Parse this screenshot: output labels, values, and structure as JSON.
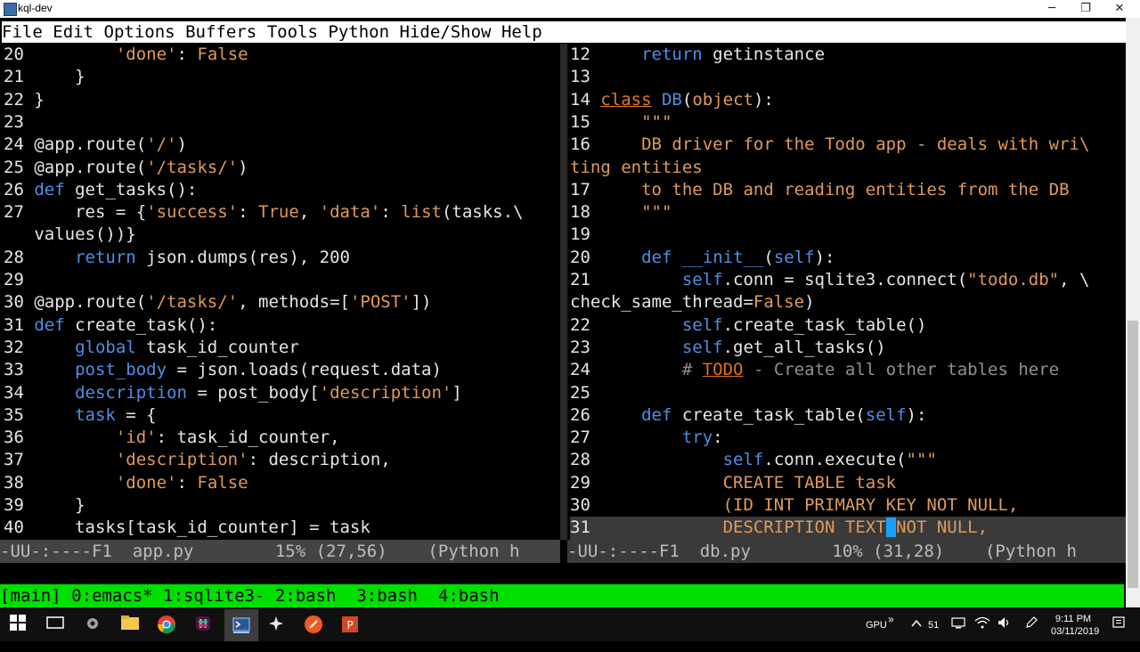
{
  "window": {
    "title": "kql-dev",
    "minimize": "─",
    "maximize": "❐",
    "close": "✕"
  },
  "menu": [
    "File",
    "Edit",
    "Options",
    "Buffers",
    "Tools",
    "Python",
    "Hide/Show",
    "Help"
  ],
  "left_pane": {
    "lines": [
      [
        {
          "t": "20 ",
          "c": "ln"
        },
        {
          "t": "        "
        },
        {
          "t": "'done'",
          "c": "str"
        },
        {
          "t": ": "
        },
        {
          "t": "False",
          "c": "str"
        }
      ],
      [
        {
          "t": "21 ",
          "c": "ln"
        },
        {
          "t": "    }"
        }
      ],
      [
        {
          "t": "22 ",
          "c": "ln"
        },
        {
          "t": "}"
        }
      ],
      [
        {
          "t": "23 ",
          "c": "ln"
        }
      ],
      [
        {
          "t": "24 ",
          "c": "ln"
        },
        {
          "t": "@app.route("
        },
        {
          "t": "'/'",
          "c": "str"
        },
        {
          "t": ")"
        }
      ],
      [
        {
          "t": "25 ",
          "c": "ln"
        },
        {
          "t": "@app.route("
        },
        {
          "t": "'/tasks/'",
          "c": "str"
        },
        {
          "t": ")"
        }
      ],
      [
        {
          "t": "26 ",
          "c": "ln"
        },
        {
          "t": "def",
          "c": "kw"
        },
        {
          "t": " get_tasks():"
        }
      ],
      [
        {
          "t": "27 ",
          "c": "ln"
        },
        {
          "t": "    res = {"
        },
        {
          "t": "'success'",
          "c": "str"
        },
        {
          "t": ": "
        },
        {
          "t": "True",
          "c": "str"
        },
        {
          "t": ", "
        },
        {
          "t": "'data'",
          "c": "str"
        },
        {
          "t": ": "
        },
        {
          "t": "list",
          "c": "str"
        },
        {
          "t": "(tasks.\\"
        }
      ],
      [
        {
          "t": "   values())}"
        }
      ],
      [
        {
          "t": "28 ",
          "c": "ln"
        },
        {
          "t": "    "
        },
        {
          "t": "return",
          "c": "kw"
        },
        {
          "t": " json.dumps(res), 200"
        }
      ],
      [
        {
          "t": "29 ",
          "c": "ln"
        }
      ],
      [
        {
          "t": "30 ",
          "c": "ln"
        },
        {
          "t": "@app.route("
        },
        {
          "t": "'/tasks/'",
          "c": "str"
        },
        {
          "t": ", methods=["
        },
        {
          "t": "'POST'",
          "c": "str"
        },
        {
          "t": "])"
        }
      ],
      [
        {
          "t": "31 ",
          "c": "ln"
        },
        {
          "t": "def",
          "c": "kw"
        },
        {
          "t": " create_task():"
        }
      ],
      [
        {
          "t": "32 ",
          "c": "ln"
        },
        {
          "t": "    "
        },
        {
          "t": "global",
          "c": "kw"
        },
        {
          "t": " task_id_counter"
        }
      ],
      [
        {
          "t": "33 ",
          "c": "ln"
        },
        {
          "t": "    "
        },
        {
          "t": "post_body",
          "c": "kw"
        },
        {
          "t": " = json.loads(request.data)"
        }
      ],
      [
        {
          "t": "34 ",
          "c": "ln"
        },
        {
          "t": "    "
        },
        {
          "t": "description",
          "c": "kw"
        },
        {
          "t": " = post_body["
        },
        {
          "t": "'description'",
          "c": "str"
        },
        {
          "t": "]"
        }
      ],
      [
        {
          "t": "35 ",
          "c": "ln"
        },
        {
          "t": "    "
        },
        {
          "t": "task",
          "c": "kw"
        },
        {
          "t": " = {"
        }
      ],
      [
        {
          "t": "36 ",
          "c": "ln"
        },
        {
          "t": "        "
        },
        {
          "t": "'id'",
          "c": "str"
        },
        {
          "t": ": task_id_counter,"
        }
      ],
      [
        {
          "t": "37 ",
          "c": "ln"
        },
        {
          "t": "        "
        },
        {
          "t": "'description'",
          "c": "str"
        },
        {
          "t": ": description,"
        }
      ],
      [
        {
          "t": "38 ",
          "c": "ln"
        },
        {
          "t": "        "
        },
        {
          "t": "'done'",
          "c": "str"
        },
        {
          "t": ": "
        },
        {
          "t": "False",
          "c": "str"
        }
      ],
      [
        {
          "t": "39 ",
          "c": "ln"
        },
        {
          "t": "    }"
        }
      ],
      [
        {
          "t": "40 ",
          "c": "ln"
        },
        {
          "t": "    tasks[task_id_counter] = task"
        }
      ]
    ]
  },
  "right_pane": {
    "lines": [
      [
        {
          "t": "12 ",
          "c": "ln"
        },
        {
          "t": "    "
        },
        {
          "t": "return",
          "c": "kw"
        },
        {
          "t": " getinstance"
        }
      ],
      [
        {
          "t": "13 ",
          "c": "ln"
        }
      ],
      [
        {
          "t": "14 ",
          "c": "ln"
        },
        {
          "t": "class",
          "c": "clsname"
        },
        {
          "t": " "
        },
        {
          "t": "DB",
          "c": "kw"
        },
        {
          "t": "("
        },
        {
          "t": "object",
          "c": "str"
        },
        {
          "t": "):"
        }
      ],
      [
        {
          "t": "15 ",
          "c": "ln"
        },
        {
          "t": "    "
        },
        {
          "t": "\"\"\"",
          "c": "str"
        }
      ],
      [
        {
          "t": "16 ",
          "c": "ln"
        },
        {
          "t": "    "
        },
        {
          "t": "DB driver for the Todo app - deals with wri\\",
          "c": "str"
        }
      ],
      [
        {
          "t": "ting entities",
          "c": "str"
        }
      ],
      [
        {
          "t": "17 ",
          "c": "ln"
        },
        {
          "t": "    "
        },
        {
          "t": "to the DB and reading entities from the DB",
          "c": "str"
        }
      ],
      [
        {
          "t": "18 ",
          "c": "ln"
        },
        {
          "t": "    "
        },
        {
          "t": "\"\"\"",
          "c": "str"
        }
      ],
      [
        {
          "t": "19 ",
          "c": "ln"
        }
      ],
      [
        {
          "t": "20 ",
          "c": "ln"
        },
        {
          "t": "    "
        },
        {
          "t": "def",
          "c": "kw"
        },
        {
          "t": " "
        },
        {
          "t": "__init__",
          "c": "kw"
        },
        {
          "t": "("
        },
        {
          "t": "self",
          "c": "kw"
        },
        {
          "t": "):"
        }
      ],
      [
        {
          "t": "21 ",
          "c": "ln"
        },
        {
          "t": "        "
        },
        {
          "t": "self",
          "c": "kw"
        },
        {
          "t": ".conn = sqlite3.connect("
        },
        {
          "t": "\"todo.db\"",
          "c": "str"
        },
        {
          "t": ", \\"
        }
      ],
      [
        {
          "t": "check_same_thread="
        },
        {
          "t": "False",
          "c": "str"
        },
        {
          "t": ")"
        }
      ],
      [
        {
          "t": "22 ",
          "c": "ln"
        },
        {
          "t": "        "
        },
        {
          "t": "self",
          "c": "kw"
        },
        {
          "t": ".create_task_table()"
        }
      ],
      [
        {
          "t": "23 ",
          "c": "ln"
        },
        {
          "t": "        "
        },
        {
          "t": "self",
          "c": "kw"
        },
        {
          "t": ".get_all_tasks()"
        }
      ],
      [
        {
          "t": "24 ",
          "c": "ln"
        },
        {
          "t": "        "
        },
        {
          "t": "# ",
          "c": "cmt"
        },
        {
          "t": "TODO",
          "c": "todo"
        },
        {
          "t": " - Create all other tables here",
          "c": "cmt"
        }
      ],
      [
        {
          "t": "25 ",
          "c": "ln"
        }
      ],
      [
        {
          "t": "26 ",
          "c": "ln"
        },
        {
          "t": "    "
        },
        {
          "t": "def",
          "c": "kw"
        },
        {
          "t": " create_task_table("
        },
        {
          "t": "self",
          "c": "kw"
        },
        {
          "t": "):"
        }
      ],
      [
        {
          "t": "27 ",
          "c": "ln"
        },
        {
          "t": "        "
        },
        {
          "t": "try",
          "c": "kw"
        },
        {
          "t": ":"
        }
      ],
      [
        {
          "t": "28 ",
          "c": "ln"
        },
        {
          "t": "            "
        },
        {
          "t": "self",
          "c": "kw"
        },
        {
          "t": ".conn.execute("
        },
        {
          "t": "\"\"\"",
          "c": "str"
        }
      ],
      [
        {
          "t": "29 ",
          "c": "ln"
        },
        {
          "t": "            "
        },
        {
          "t": "CREATE TABLE task",
          "c": "str"
        }
      ],
      [
        {
          "t": "30 ",
          "c": "ln"
        },
        {
          "t": "            "
        },
        {
          "t": "(ID INT PRIMARY KEY NOT NULL,",
          "c": "str"
        }
      ],
      [
        {
          "t": "31 ",
          "c": "ln"
        },
        {
          "t": "            "
        },
        {
          "t": "DESCRIPTION TEXT",
          "c": "str"
        },
        {
          "t": " ",
          "c": "cursor"
        },
        {
          "t": "NOT NULL,",
          "c": "str"
        }
      ]
    ]
  },
  "left_modeline": "-UU-:----F1  app.py        15% (27,56)    (Python h",
  "right_modeline": "-UU-:----F1  db.py        10% (31,28)    (Python h",
  "tmux_status": "[main] 0:emacs* 1:sqlite3- 2:bash  3:bash  4:bash",
  "taskbar": {
    "tray_gpu": "GPU",
    "tray_chevron": "»",
    "tray_num": "51",
    "time": "9:11 PM",
    "date": "03/11/2019"
  }
}
